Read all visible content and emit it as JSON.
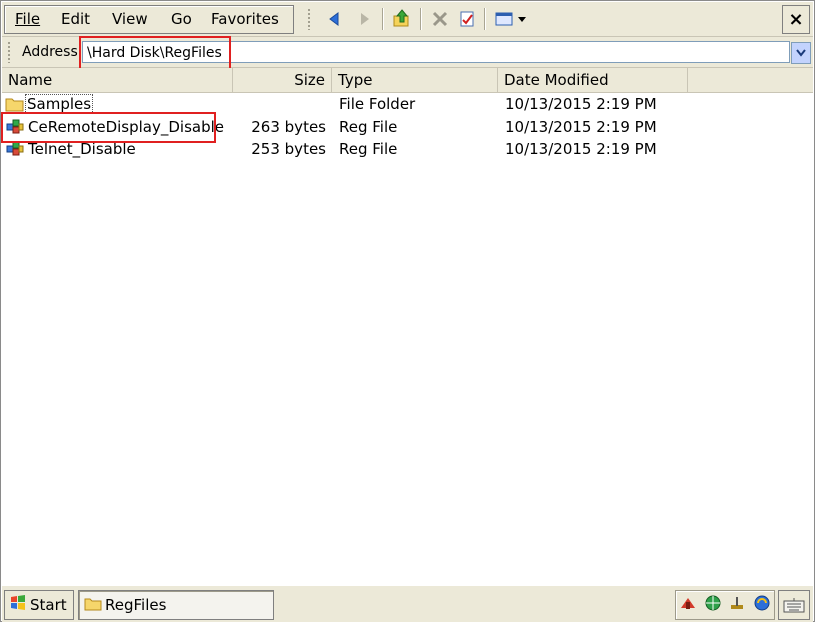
{
  "menu": {
    "file": "File",
    "edit": "Edit",
    "view": "View",
    "go": "Go",
    "favorites": "Favorites"
  },
  "toolbar": {
    "icons": [
      "back-icon",
      "forward-icon",
      "up-folder-icon",
      "delete-icon",
      "properties-icon",
      "views-icon"
    ],
    "close_label": "×"
  },
  "address": {
    "label": "Address",
    "value": "\\Hard Disk\\RegFiles"
  },
  "columns": {
    "name": "Name",
    "size": "Size",
    "type": "Type",
    "date": "Date Modified"
  },
  "files": [
    {
      "name": "Samples",
      "size": "",
      "type": "File Folder",
      "date": "10/13/2015 2:19 PM",
      "icon": "folder-icon"
    },
    {
      "name": "CeRemoteDisplay_Disable",
      "size": "263 bytes",
      "type": "Reg File",
      "date": "10/13/2015 2:19 PM",
      "icon": "reg-file-icon"
    },
    {
      "name": "Telnet_Disable",
      "size": "253 bytes",
      "type": "Reg File",
      "date": "10/13/2015 2:19 PM",
      "icon": "reg-file-icon"
    }
  ],
  "taskbar": {
    "start": "Start",
    "window": "RegFiles"
  },
  "colors": {
    "highlight": "#e02020",
    "chrome": "#ece9d8"
  }
}
